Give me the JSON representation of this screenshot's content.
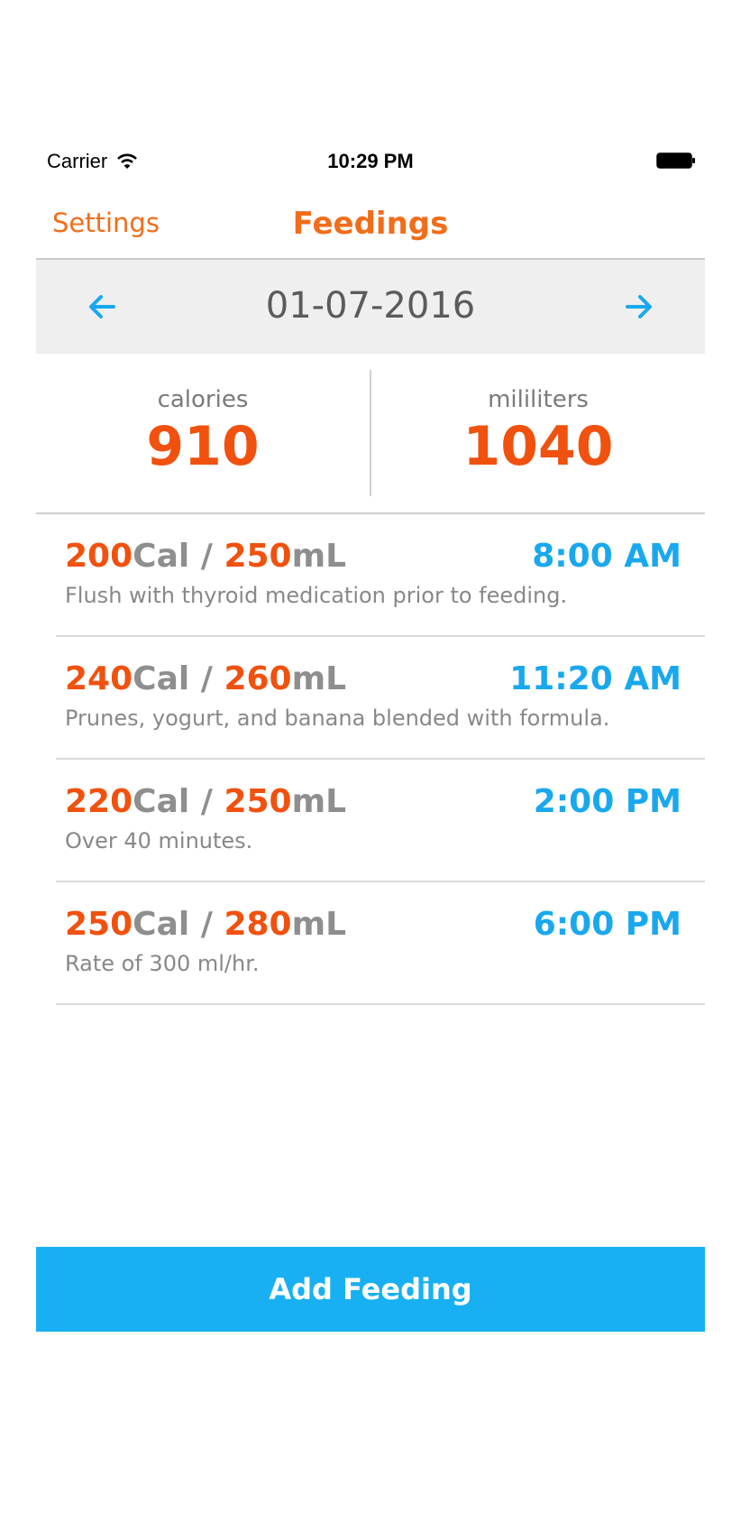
{
  "status_bar": {
    "carrier": "Carrier",
    "time": "10:29 PM",
    "icons": [
      "wifi-icon",
      "battery-icon"
    ]
  },
  "nav": {
    "left_label": "Settings",
    "title": "Feedings"
  },
  "date_bar": {
    "date": "01-07-2016",
    "prev_icon": "arrow-left-icon",
    "next_icon": "arrow-right-icon"
  },
  "summary": {
    "calories_label": "calories",
    "calories_value": "910",
    "ml_label": "mililiters",
    "ml_value": "1040"
  },
  "feedings": [
    {
      "cal": "200",
      "cal_unit": "Cal",
      "sep": " / ",
      "ml": "250",
      "ml_unit": "mL",
      "time": "8:00 AM",
      "note": "Flush with thyroid medication prior to feeding."
    },
    {
      "cal": "240",
      "cal_unit": "Cal",
      "sep": " / ",
      "ml": "260",
      "ml_unit": "mL",
      "time": "11:20 AM",
      "note": "Prunes, yogurt, and banana blended with formula."
    },
    {
      "cal": "220",
      "cal_unit": "Cal",
      "sep": " / ",
      "ml": "250",
      "ml_unit": "mL",
      "time": "2:00 PM",
      "note": "Over 40 minutes."
    },
    {
      "cal": "250",
      "cal_unit": "Cal",
      "sep": " / ",
      "ml": "280",
      "ml_unit": "mL",
      "time": "6:00 PM",
      "note": "Rate of 300 ml/hr."
    }
  ],
  "add_button_label": "Add Feeding",
  "colors": {
    "accent_orange": "#f16d1a",
    "value_orange": "#f1510e",
    "accent_blue": "#19a8ee",
    "button_blue": "#18b0f2"
  }
}
